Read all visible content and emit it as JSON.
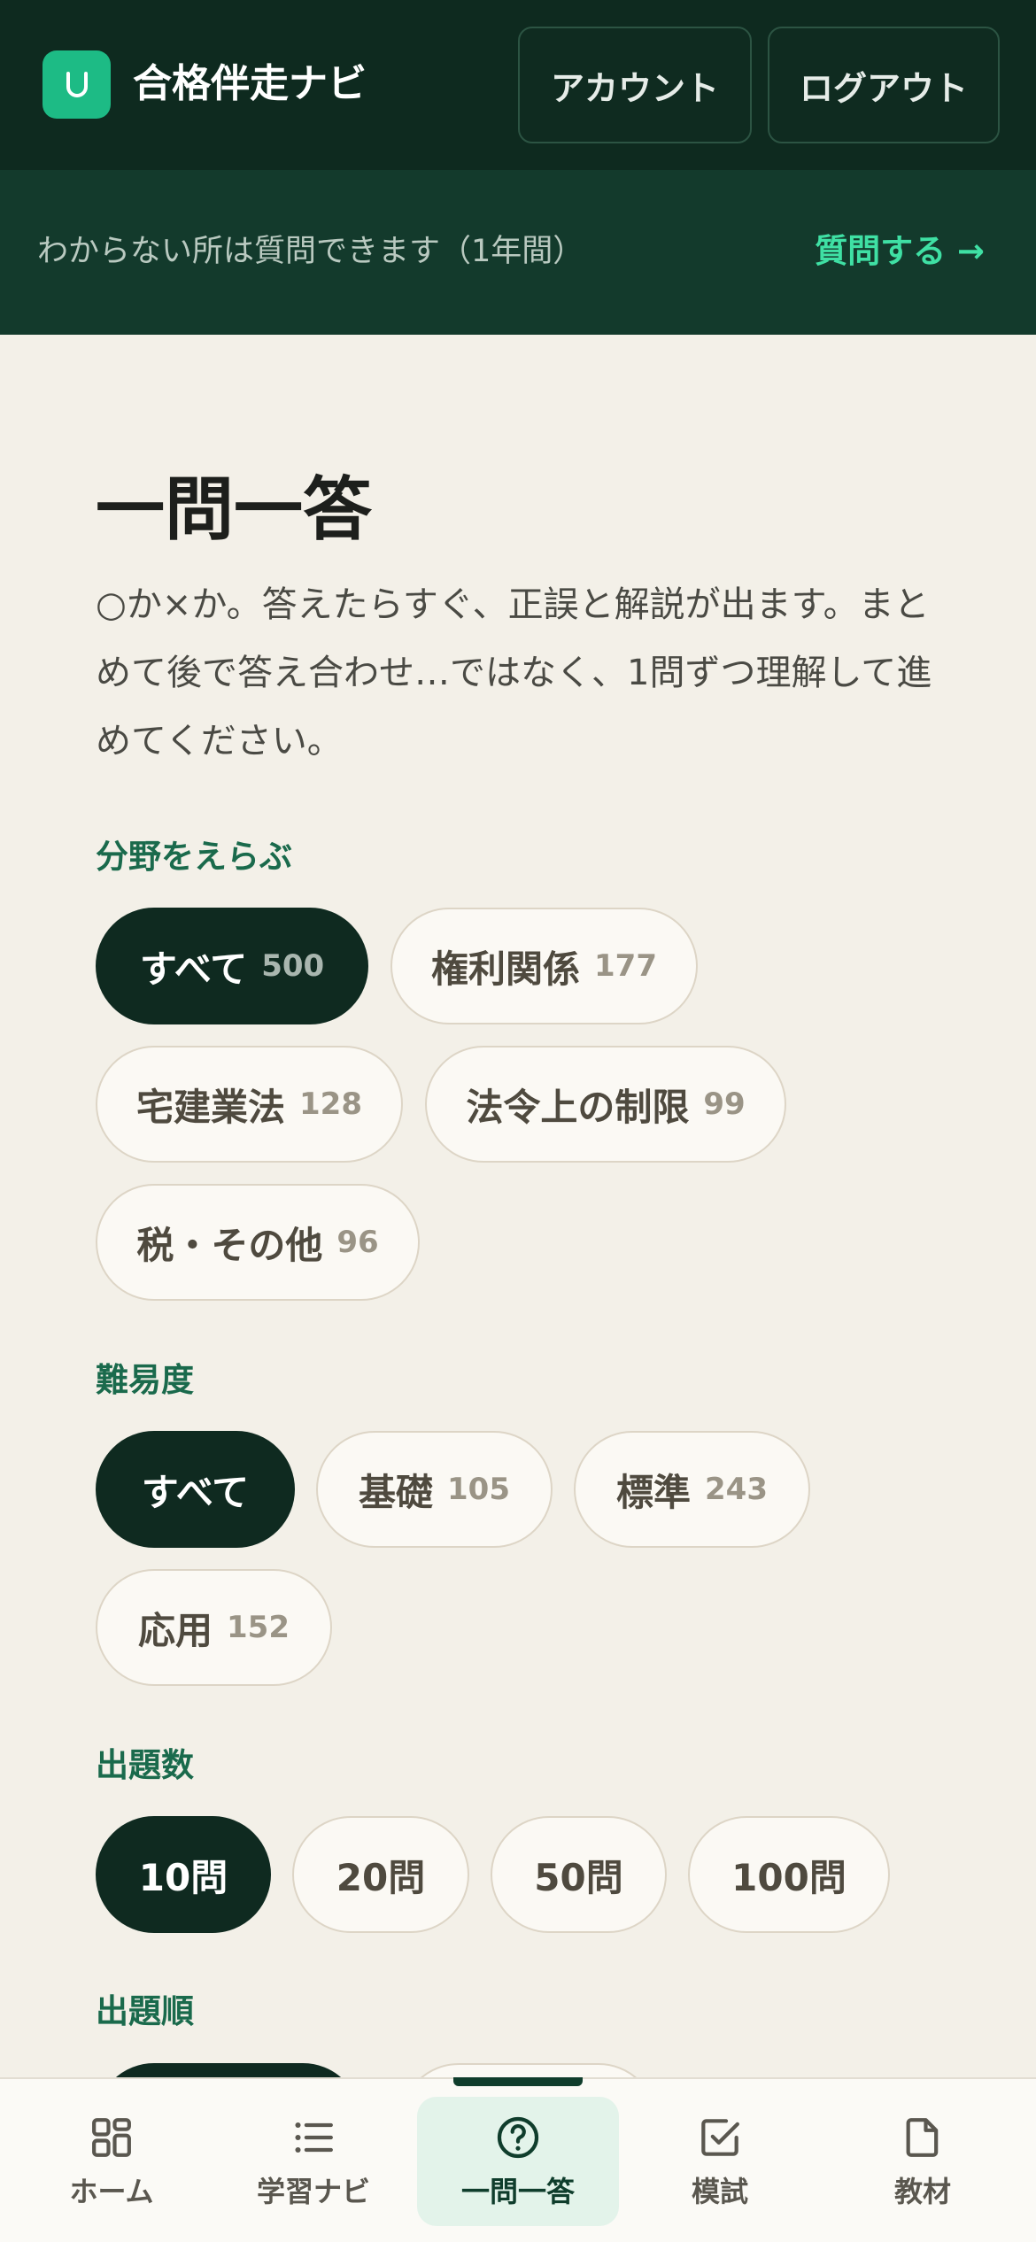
{
  "header": {
    "brand": "合格伴走ナビ",
    "account_label": "アカウント",
    "logout_label": "ログアウト",
    "logo_icon": "u-logo-icon",
    "accent_color": "#1dbb85"
  },
  "banner": {
    "text": "わからない所は質問できます（1年間）",
    "link_label": "質問する →"
  },
  "main": {
    "title": "一問一答",
    "description": "○か×か。答えたらすぐ、正誤と解説が出ます。まとめて後で答え合わせ…ではなく、1問ずつ理解して進めてください。"
  },
  "filters": {
    "field": {
      "label": "分野をえらぶ",
      "options": [
        {
          "label": "すべて",
          "count": "500",
          "selected": true
        },
        {
          "label": "権利関係",
          "count": "177",
          "selected": false
        },
        {
          "label": "宅建業法",
          "count": "128",
          "selected": false
        },
        {
          "label": "法令上の制限",
          "count": "99",
          "selected": false
        },
        {
          "label": "税・その他",
          "count": "96",
          "selected": false
        }
      ]
    },
    "difficulty": {
      "label": "難易度",
      "options": [
        {
          "label": "すべて",
          "selected": true
        },
        {
          "label": "基礎",
          "count": "105",
          "selected": false
        },
        {
          "label": "標準",
          "count": "243",
          "selected": false
        },
        {
          "label": "応用",
          "count": "152",
          "selected": false
        }
      ]
    },
    "question_count": {
      "label": "出題数",
      "options": [
        {
          "label": "10問",
          "selected": true
        },
        {
          "label": "20問",
          "selected": false
        },
        {
          "label": "50問",
          "selected": false
        },
        {
          "label": "100問",
          "selected": false
        }
      ]
    },
    "order": {
      "label": "出題順"
    }
  },
  "bottom_nav": {
    "items": [
      {
        "label": "ホーム",
        "icon": "grid-icon",
        "active": false
      },
      {
        "label": "学習ナビ",
        "icon": "list-icon",
        "active": false
      },
      {
        "label": "一問一答",
        "icon": "question-circle-icon",
        "active": true
      },
      {
        "label": "模試",
        "icon": "check-square-icon",
        "active": false
      },
      {
        "label": "教材",
        "icon": "document-icon",
        "active": false
      }
    ]
  }
}
